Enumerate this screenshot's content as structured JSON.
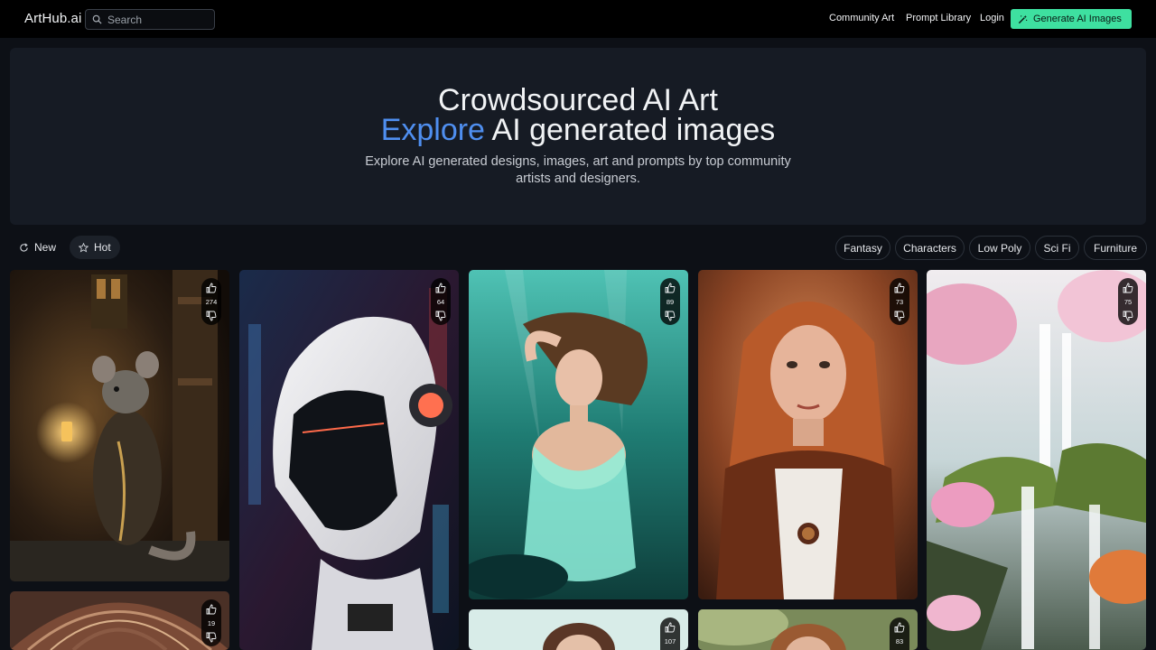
{
  "header": {
    "logo": "ArtHub.ai",
    "search_placeholder": "Search",
    "nav": [
      "Community Art",
      "Prompt Library",
      "Login"
    ],
    "cta": "Generate AI Images",
    "cta_color": "#3ee0a0"
  },
  "hero": {
    "title_line1": "Crowdsourced AI Art",
    "title_accent": "Explore",
    "title_line2_rest": " AI generated images",
    "subtitle": "Explore AI generated designs, images, art and prompts by top community artists and designers.",
    "accent_color": "#4f8ff0"
  },
  "sort": {
    "new_label": "New",
    "hot_label": "Hot",
    "active": "Hot"
  },
  "tags": [
    "Fantasy",
    "Characters",
    "Low Poly",
    "Sci Fi",
    "Furniture"
  ],
  "cards": [
    {
      "subject": "mouse-with-lantern",
      "likes": "274"
    },
    {
      "subject": "robot-helmet",
      "likes": "64"
    },
    {
      "subject": "underwater-woman",
      "likes": "89"
    },
    {
      "subject": "redhead-portrait",
      "likes": "73"
    },
    {
      "subject": "waterfall-cherry-blossoms",
      "likes": "75"
    },
    {
      "subject": "ornate-dome",
      "likes": "19"
    },
    {
      "subject": "woman-portrait",
      "likes": "107"
    },
    {
      "subject": "forest-portrait",
      "likes": "83"
    }
  ]
}
